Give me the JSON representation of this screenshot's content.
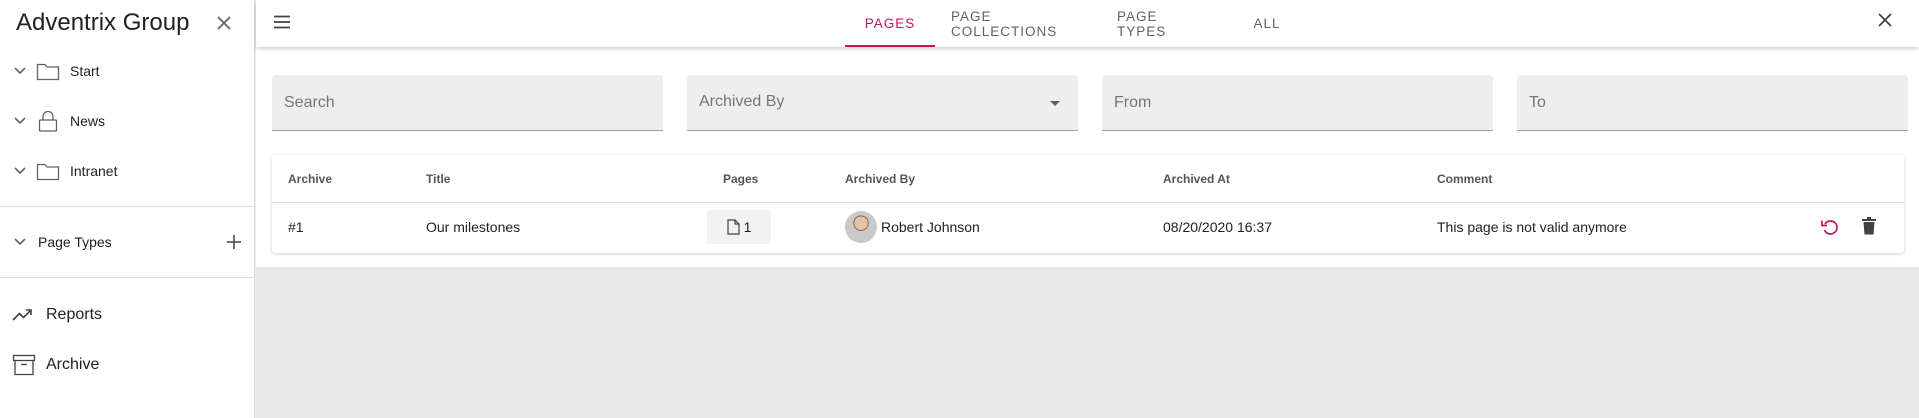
{
  "sidebar": {
    "title": "Adventrix Group",
    "tree": [
      {
        "label": "Start",
        "icon": "folder-icon"
      },
      {
        "label": "News",
        "icon": "lock-icon"
      },
      {
        "label": "Intranet",
        "icon": "folder-icon"
      }
    ],
    "page_types": {
      "label": "Page Types"
    },
    "nav": [
      {
        "label": "Reports",
        "icon": "trending-up-icon"
      },
      {
        "label": "Archive",
        "icon": "archive-box-icon"
      }
    ]
  },
  "topbar": {
    "tabs": [
      "PAGES",
      "PAGE COLLECTIONS",
      "PAGE TYPES",
      "ALL"
    ],
    "active_tab": "PAGES"
  },
  "filters": {
    "search_placeholder": "Search",
    "archived_by_label": "Archived By",
    "from_placeholder": "From",
    "to_placeholder": "To"
  },
  "table": {
    "columns": [
      "Archive",
      "Title",
      "Pages",
      "Archived By",
      "Archived At",
      "Comment"
    ],
    "rows": [
      {
        "archive": "#1",
        "title": "Our milestones",
        "pages": "1",
        "archived_by": "Robert Johnson",
        "archived_at": "08/20/2020 16:37",
        "comment": "This page is not valid anymore"
      }
    ]
  },
  "colors": {
    "accent": "#c2185b",
    "background": "#e8e8e8"
  }
}
